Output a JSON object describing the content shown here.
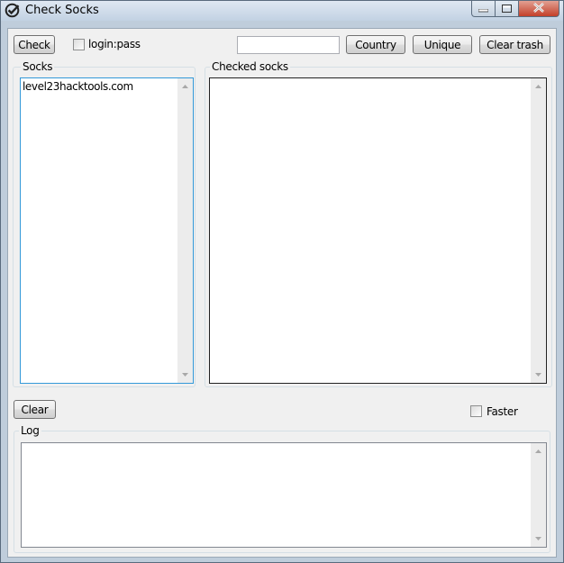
{
  "window": {
    "title": "Check Socks"
  },
  "toolbar": {
    "check_label": "Check",
    "loginpass_label": "login:pass",
    "filter_value": "",
    "country_label": "Country",
    "unique_label": "Unique",
    "clear_trash_label": "Clear trash"
  },
  "socks": {
    "label": "Socks",
    "items": [
      "level23hacktools.com"
    ]
  },
  "checked": {
    "label": "Checked socks",
    "items": []
  },
  "bottom": {
    "clear_label": "Clear",
    "faster_label": "Faster"
  },
  "log": {
    "label": "Log",
    "items": []
  },
  "colors": {
    "focus_border": "#3399d9",
    "close_button": "#c3402a"
  }
}
